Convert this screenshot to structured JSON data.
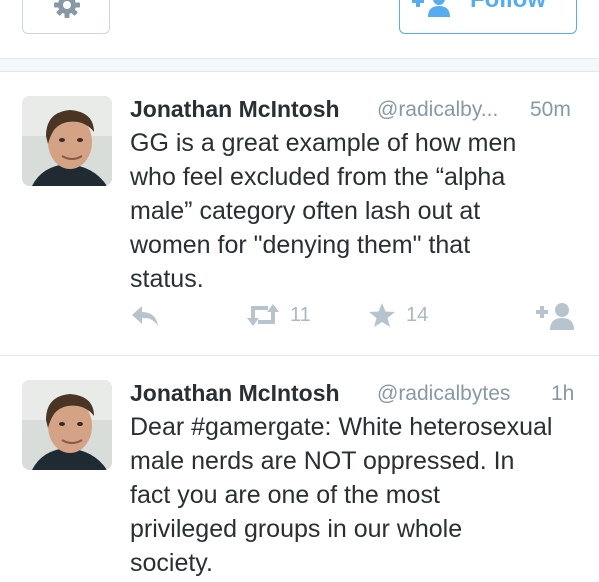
{
  "header": {
    "settings_icon": "gear-icon",
    "follow_label": "Follow",
    "follow_icon": "add-user-icon",
    "accent_color": "#55acee"
  },
  "tweets": [
    {
      "name": "Jonathan McIntosh",
      "handle": "@radicalby...",
      "time": "50m",
      "lines": [
        "GG is a great example of how men",
        "who feel excluded from the “alpha",
        "male” category often lash out at",
        "women for \"denying them\" that",
        "status."
      ],
      "retweets": "11",
      "favorites": "14"
    },
    {
      "name": "Jonathan McIntosh",
      "handle": "@radicalbytes",
      "time": "1h",
      "lines": [
        "Dear #gamergate: White heterosexual",
        "male nerds are NOT oppressed. In",
        "fact you are one of the most",
        "privileged groups in our whole",
        "society."
      ]
    }
  ]
}
